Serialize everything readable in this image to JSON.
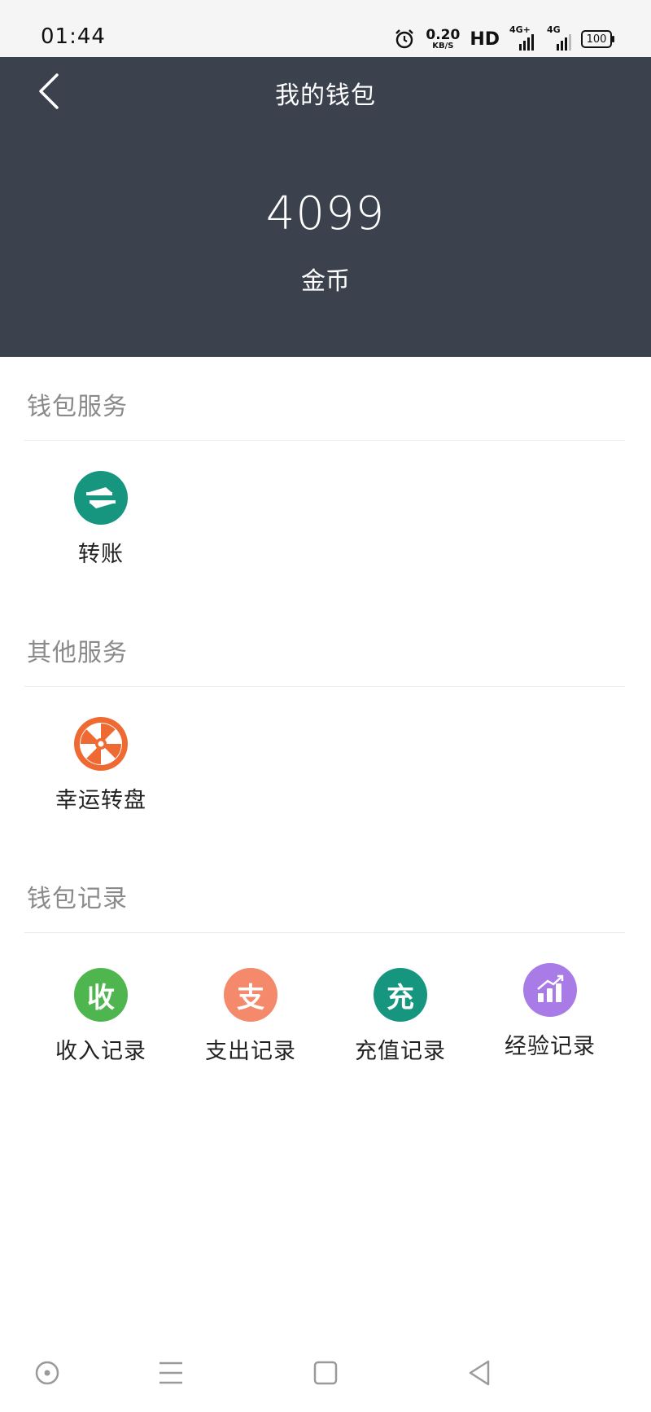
{
  "status_bar": {
    "time": "01:44",
    "speed_value": "0.20",
    "speed_unit": "KB/S",
    "hd": "HD",
    "signal1": "4G+",
    "signal2": "4G",
    "battery": "100",
    "icons": [
      "alarm-icon",
      "signal-icon",
      "battery-icon"
    ]
  },
  "header": {
    "title": "我的钱包",
    "balance": "4099",
    "balance_label": "金币",
    "background": "#3b414d"
  },
  "sections": {
    "wallet_services": {
      "title": "钱包服务",
      "items": [
        {
          "label": "转账",
          "icon": "transfer-icon",
          "color": "#16967f"
        }
      ]
    },
    "other_services": {
      "title": "其他服务",
      "items": [
        {
          "label": "幸运转盘",
          "icon": "lucky-wheel-icon",
          "color": "#ef6a33"
        }
      ]
    },
    "wallet_records": {
      "title": "钱包记录",
      "items": [
        {
          "label": "收入记录",
          "glyph": "收",
          "icon": "income-icon",
          "color": "#4fb64f"
        },
        {
          "label": "支出记录",
          "glyph": "支",
          "icon": "expense-icon",
          "color": "#f4896b"
        },
        {
          "label": "充值记录",
          "glyph": "充",
          "icon": "recharge-icon",
          "color": "#16967f"
        },
        {
          "label": "经验记录",
          "icon": "experience-chart-icon",
          "color": "#a97be6"
        }
      ]
    }
  },
  "nav_bar": {
    "buttons": [
      "assistant-icon",
      "menu-icon",
      "home-icon",
      "back-icon"
    ]
  }
}
